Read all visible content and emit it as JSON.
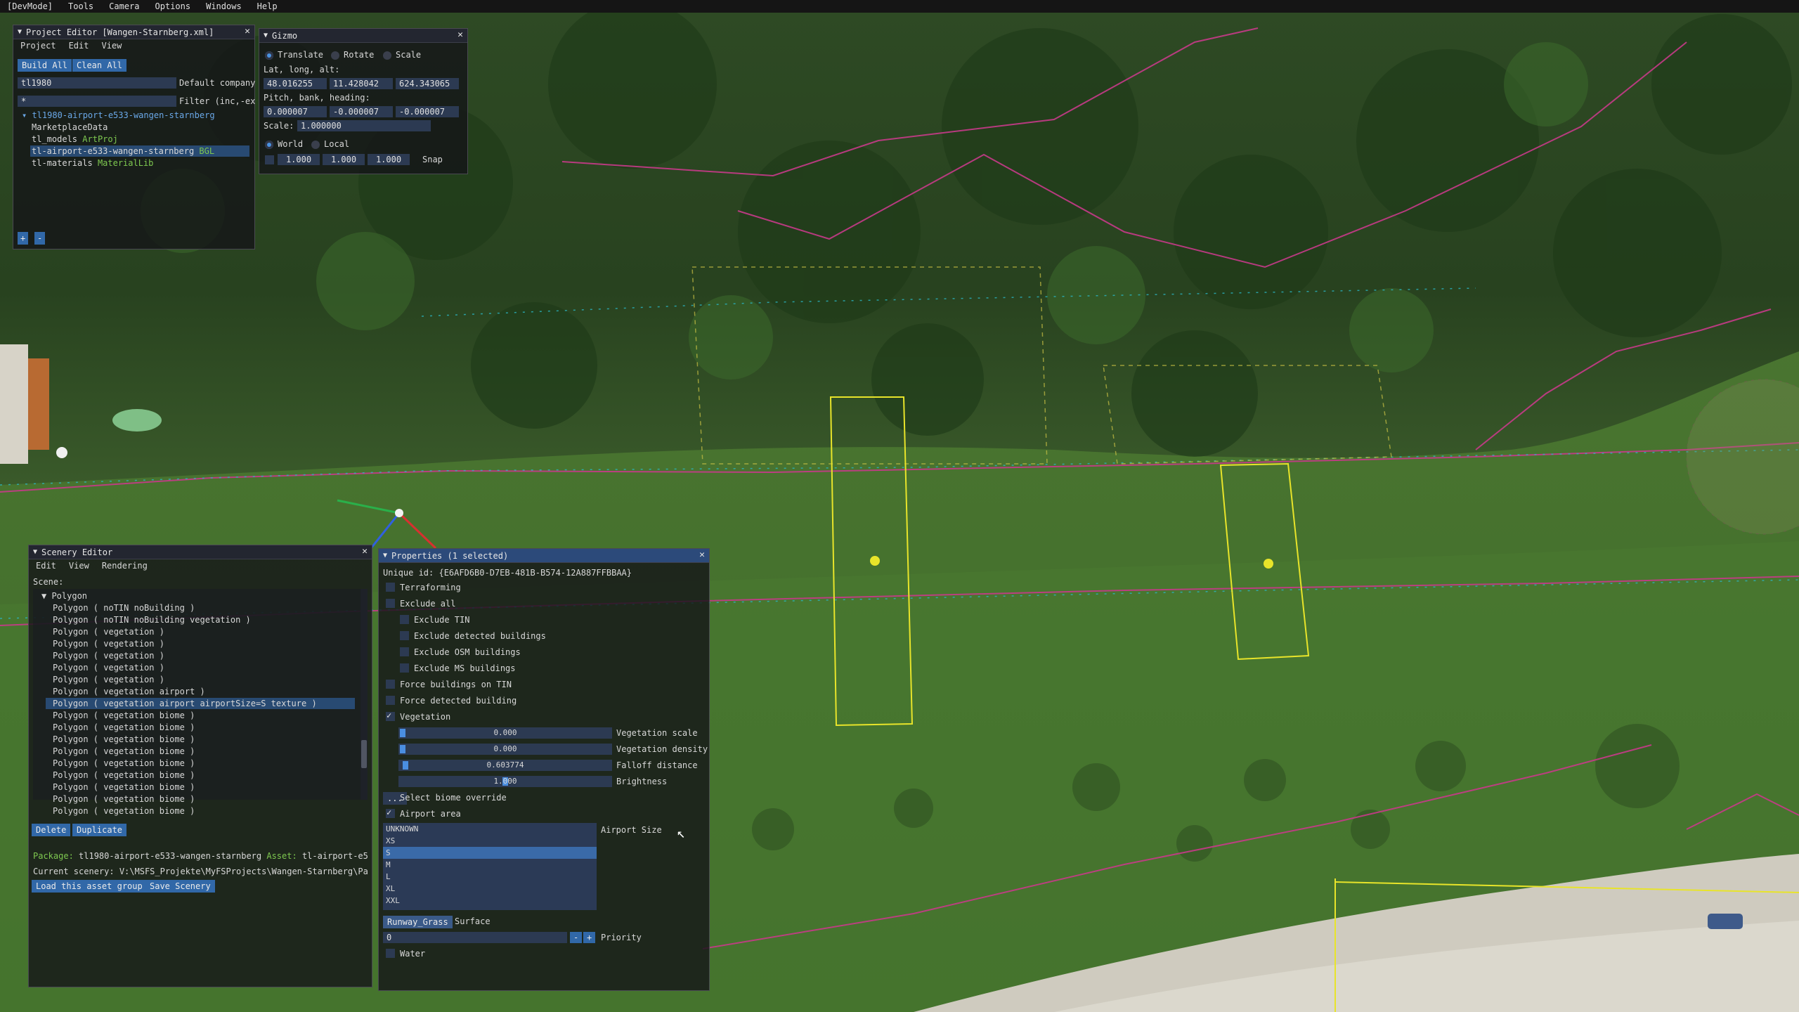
{
  "menubar": [
    "[DevMode]",
    "Tools",
    "Camera",
    "Options",
    "Windows",
    "Help"
  ],
  "project_editor": {
    "title": "Project Editor [Wangen-Starnberg.xml]",
    "menu": [
      "Project",
      "Edit",
      "View"
    ],
    "build_all": "Build All",
    "clean_all": "Clean All",
    "company_value": "tl1980",
    "company_label": "Default company",
    "filter_value": "*",
    "filter_label": "Filter (inc,-ex",
    "tree_root": "tl1980-airport-e533-wangen-starnberg",
    "items": [
      {
        "name": "MarketplaceData",
        "tag": ""
      },
      {
        "name": "tl_models",
        "tag": "ArtProj"
      },
      {
        "name": "tl-airport-e533-wangen-starnberg",
        "tag": "BGL"
      },
      {
        "name": "tl-materials",
        "tag": "MaterialLib"
      }
    ],
    "add": "+",
    "remove": "-"
  },
  "gizmo": {
    "title": "Gizmo",
    "modes": [
      "Translate",
      "Rotate",
      "Scale"
    ],
    "latlongalt_label": "Lat, long, alt:",
    "lat": "48.016255",
    "long": "11.428042",
    "alt": "624.343065",
    "pbh_label": "Pitch, bank, heading:",
    "pitch": "0.000007",
    "bank": "-0.000007",
    "heading": "-0.000007",
    "scale_label": "Scale:",
    "scale": "1.000000",
    "spaces": [
      "World",
      "Local"
    ],
    "snap1": "1.000",
    "snap2": "1.000",
    "snap3": "1.000",
    "snap_label": "Snap"
  },
  "scenery_editor": {
    "title": "Scenery Editor",
    "menu": [
      "Edit",
      "View",
      "Rendering"
    ],
    "scene_label": "Scene:",
    "group": "Polygon",
    "items": [
      "Polygon  ( noTIN noBuilding )",
      "Polygon  ( noTIN noBuilding vegetation )",
      "Polygon  ( vegetation )",
      "Polygon  ( vegetation )",
      "Polygon  ( vegetation )",
      "Polygon  ( vegetation )",
      "Polygon  ( vegetation )",
      "Polygon  ( vegetation airport )",
      "Polygon  ( vegetation airport airportSize=S texture )",
      "Polygon  ( vegetation biome )",
      "Polygon  ( vegetation biome )",
      "Polygon  ( vegetation biome )",
      "Polygon  ( vegetation biome )",
      "Polygon  ( vegetation biome )",
      "Polygon  ( vegetation biome )",
      "Polygon  ( vegetation biome )",
      "Polygon  ( vegetation biome )",
      "Polygon  ( vegetation biome )"
    ],
    "delete": "Delete",
    "duplicate": "Duplicate",
    "package_label": "Package:",
    "package_value": "tl1980-airport-e533-wangen-starnberg",
    "asset_label": "Asset:",
    "asset_value": "tl-airport-e5",
    "current_scenery": "Current scenery: V:\\MSFS_Projekte\\MyFSProjects\\Wangen-Starnberg\\Packa",
    "load_group": "Load this asset group",
    "save_scenery": "Save Scenery"
  },
  "properties": {
    "title": "Properties (1 selected)",
    "unique_id": "Unique id: {E6AFD6B0-D7EB-481B-B574-12A887FFBBAA}",
    "terraforming": "Terraforming",
    "exclude_all": "Exclude all",
    "exclude_tin": "Exclude TIN",
    "exclude_detected": "Exclude detected buildings",
    "exclude_osm": "Exclude OSM buildings",
    "exclude_ms": "Exclude MS buildings",
    "force_tin": "Force buildings on TIN",
    "force_detected": "Force detected building",
    "vegetation": "Vegetation",
    "veg_scale_value": "0.000",
    "veg_scale_label": "Vegetation scale",
    "veg_density_value": "0.000",
    "veg_density_label": "Vegetation density",
    "falloff_value": "0.603774",
    "falloff_label": "Falloff distance",
    "brightness_value": "1.000",
    "brightness_label": "Brightness",
    "biome_button": "...",
    "biome_label": "Select biome override",
    "airport_area": "Airport area",
    "airport_size_label": "Airport Size",
    "sizes": [
      "UNKNOWN",
      "XS",
      "S",
      "M",
      "L",
      "XL",
      "XXL"
    ],
    "selected_size": "S",
    "surface_value": "Runway_Grass",
    "surface_label": "Surface",
    "priority_value": "0",
    "priority_minus": "-",
    "priority_plus": "+",
    "priority_label": "Priority",
    "water": "Water"
  }
}
